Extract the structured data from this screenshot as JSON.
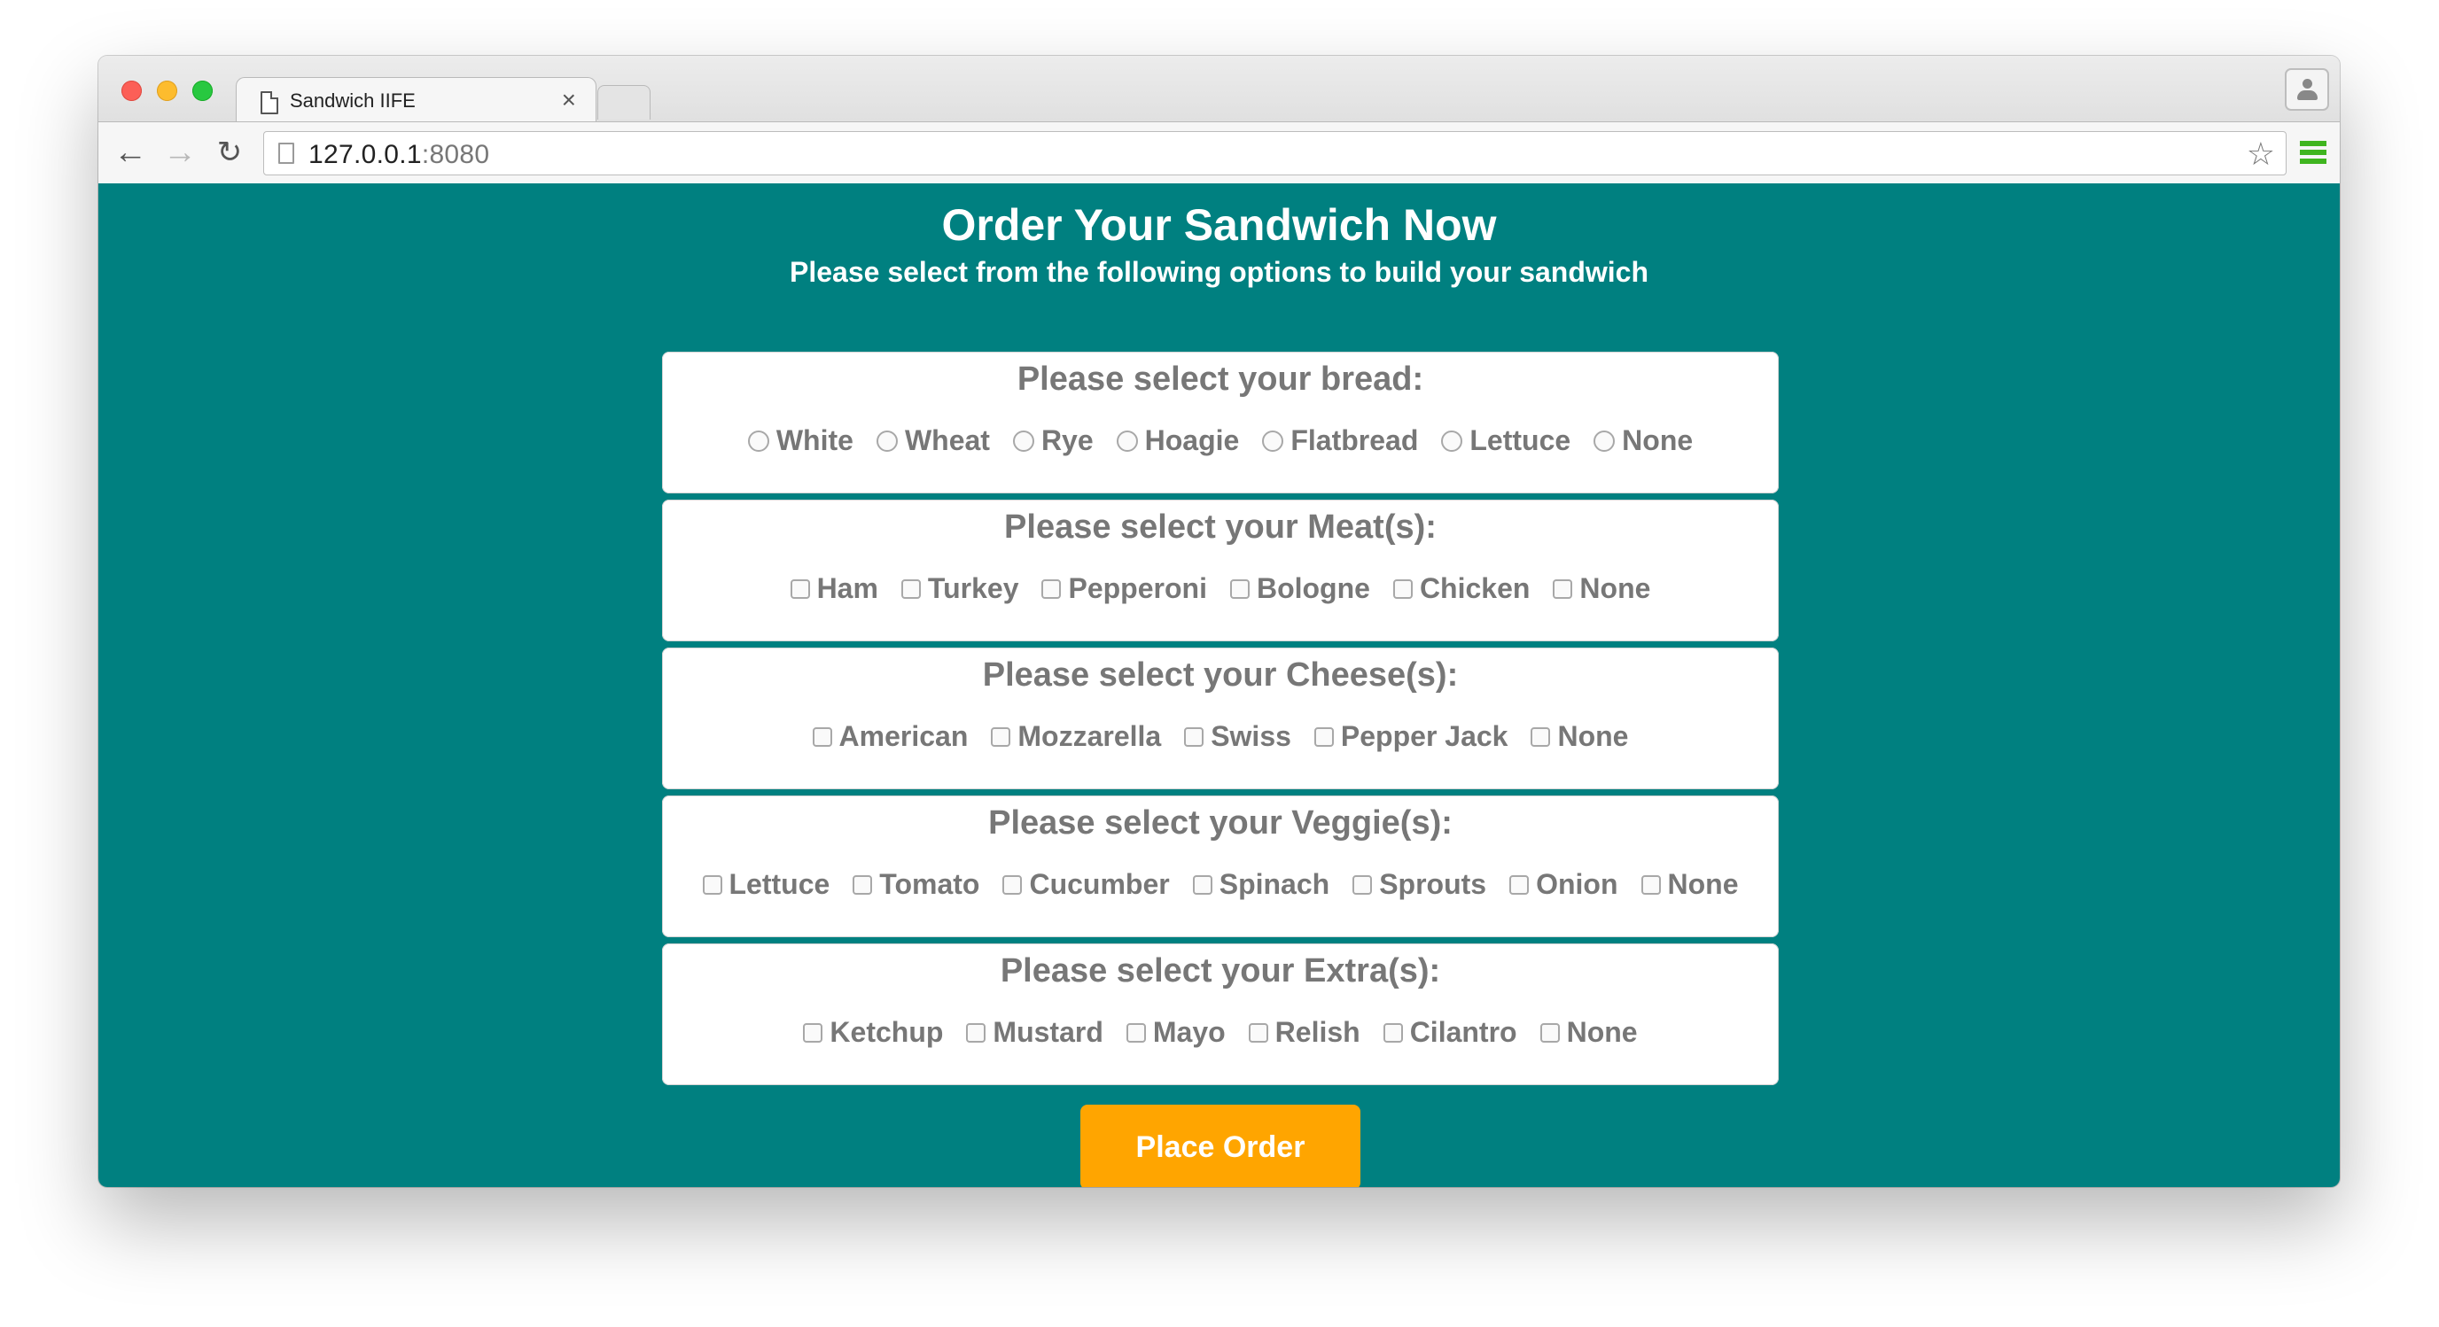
{
  "browser": {
    "tab_title": "Sandwich IIFE",
    "tab_close": "×",
    "url_host": "127.0.0.1",
    "url_port": ":8080"
  },
  "page": {
    "title": "Order Your Sandwich Now",
    "subtitle": "Please select from the following options to build your sandwich",
    "order_button": "Place Order"
  },
  "sections": {
    "bread": {
      "heading": "Please select your bread:",
      "input_type": "radio",
      "options": [
        "White",
        "Wheat",
        "Rye",
        "Hoagie",
        "Flatbread",
        "Lettuce",
        "None"
      ]
    },
    "meat": {
      "heading": "Please select your Meat(s):",
      "input_type": "checkbox",
      "options": [
        "Ham",
        "Turkey",
        "Pepperoni",
        "Bologne",
        "Chicken",
        "None"
      ]
    },
    "cheese": {
      "heading": "Please select your Cheese(s):",
      "input_type": "checkbox",
      "options": [
        "American",
        "Mozzarella",
        "Swiss",
        "Pepper Jack",
        "None"
      ]
    },
    "veggie": {
      "heading": "Please select your Veggie(s):",
      "input_type": "checkbox",
      "options": [
        "Lettuce",
        "Tomato",
        "Cucumber",
        "Spinach",
        "Sprouts",
        "Onion",
        "None"
      ]
    },
    "extra": {
      "heading": "Please select your Extra(s):",
      "input_type": "checkbox",
      "options": [
        "Ketchup",
        "Mustard",
        "Mayo",
        "Relish",
        "Cilantro",
        "None"
      ]
    }
  },
  "colors": {
    "page_background": "#008080",
    "order_button": "#ffa500",
    "section_text": "#777777"
  },
  "icons": [
    "document-icon",
    "close-icon",
    "back-arrow-icon",
    "forward-arrow-icon",
    "reload-icon",
    "bookmark-star-icon",
    "menu-icon",
    "profile-icon"
  ]
}
